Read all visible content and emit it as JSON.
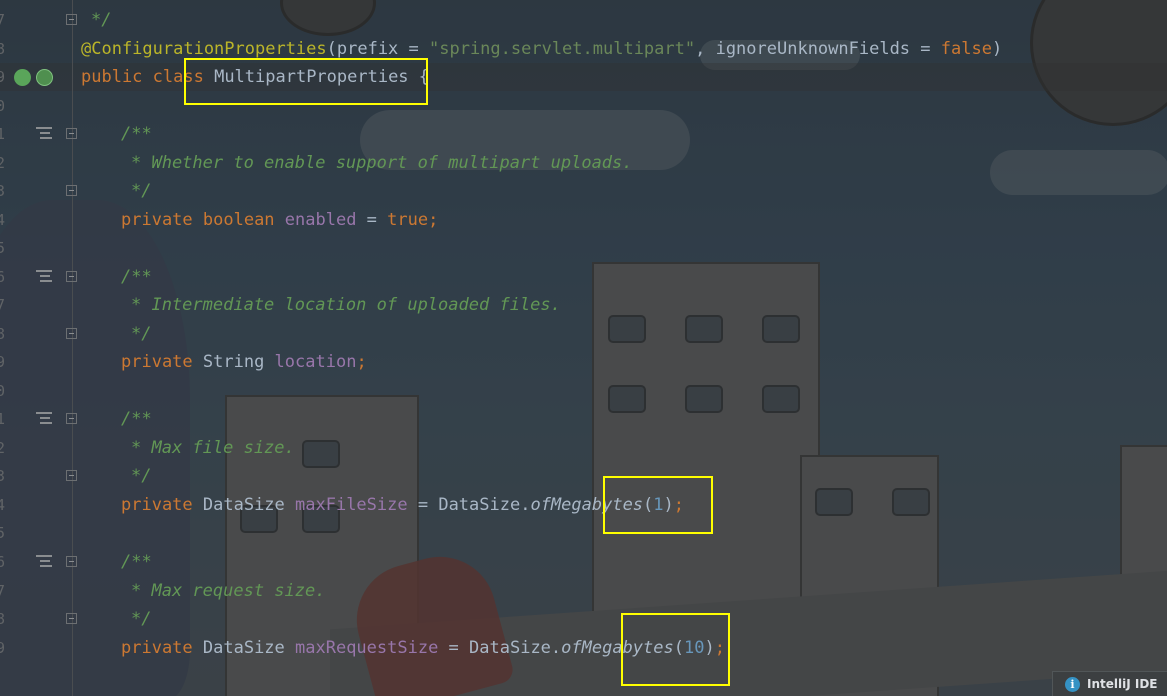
{
  "gutter": {
    "line_numbers": [
      "7",
      "8",
      "9",
      "0",
      "1",
      "2",
      "3",
      "4",
      "5",
      "6",
      "7",
      "8",
      "9",
      "0",
      "1",
      "2",
      "3",
      "4",
      "5",
      "6",
      "7",
      "8",
      "9"
    ]
  },
  "code": {
    "l7_text": "*/",
    "l8_annotation": "@ConfigurationProperties",
    "l8_open": "(prefix = ",
    "l8_prefix_value": "\"spring.servlet.multipart\"",
    "l8_mid": ", ignoreUnknownFields = ",
    "l8_false": "false",
    "l8_close": ")",
    "l9_public": "public ",
    "l9_class": "class ",
    "l9_name": "MultipartProperties",
    "l9_brace": " {",
    "doc_open": "/**",
    "doc_close": "*/",
    "doc_enabled": "* Whether to enable support of multipart uploads.",
    "doc_location": "* Intermediate location of uploaded files.",
    "doc_max_file": "* Max file size.",
    "doc_max_request": "* Max request size.",
    "private_kw": "private ",
    "boolean_kw": "boolean ",
    "enabled_field": "enabled",
    "assign": " = ",
    "true_kw": "true",
    "semicolon": ";",
    "string_type": "String ",
    "location_field": "location",
    "datasize_type": "DataSize ",
    "max_file_field": "maxFileSize",
    "datasize_ref": "DataSize.",
    "of_megabytes": "ofMegabytes",
    "paren_open": "(",
    "paren_close": ")",
    "max_file_value": "1",
    "max_request_field": "maxRequestSize",
    "max_request_value": "10"
  },
  "notification": {
    "label": "IntelliJ IDE",
    "icon": "info-icon"
  },
  "colors": {
    "highlight_box": "#ffff00",
    "keyword": "#cc7832",
    "annotation": "#bbb529",
    "string": "#6a8759",
    "number": "#6897bb",
    "field": "#9876aa",
    "javadoc": "#629755"
  }
}
